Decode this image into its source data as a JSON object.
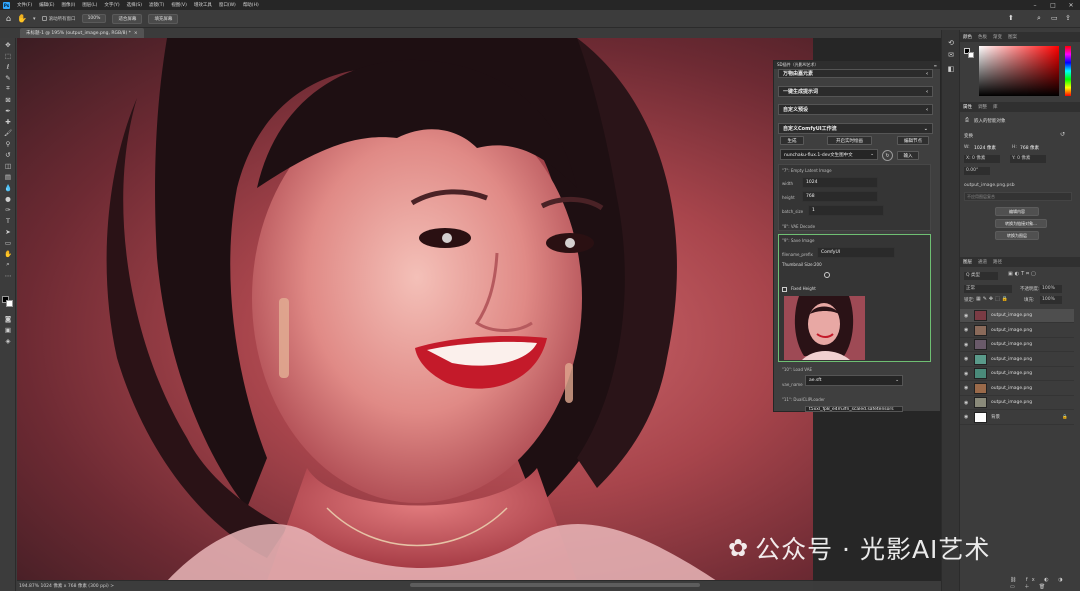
{
  "app": {
    "menus": [
      "文件(F)",
      "编辑(E)",
      "图像(I)",
      "图层(L)",
      "文字(Y)",
      "选择(S)",
      "滤镜(T)",
      "视图(V)",
      "增效工具",
      "窗口(W)",
      "帮助(H)"
    ],
    "ps_logo": "Ps"
  },
  "options": {
    "scroll_all_windows": "滚动所有窗口",
    "zoom": "100%",
    "fit_screen": "适合屏幕",
    "fill_screen": "填充屏幕"
  },
  "document": {
    "tab_title": "未标题-1 @ 195% (output_image.png, RGB/8) *",
    "status": "194.87%   1024 像素 x 768 像素 (300 ppi)   >"
  },
  "comfy": {
    "panel_title": "SD插件（光影AI艺术）",
    "sections": {
      "quick": "万物由嘉元素",
      "prompt": "一键生成提示词",
      "preset": "自定义预设",
      "workflow": "自定义ComfyUI工作流"
    },
    "buttons": {
      "generate": "生成",
      "realtime": "开启实时绘画",
      "edit_node": "编辑节点",
      "import": "输入"
    },
    "workflow_select": "nunchaku-flux.1-dev文生图中文",
    "nodes": {
      "latent": "\"7\": Empty Latent Image",
      "width_label": "width",
      "width_value": "1024",
      "height_label": "height",
      "height_value": "768",
      "batch_label": "batch_size",
      "batch_value": "1",
      "vae_decode": "\"8\": VAE Decode",
      "save_image": "\"9\": Save Image",
      "filename_label": "filename_prefix",
      "filename_value": "ComfyUI",
      "thumb_size": "Thumbnail Size:200",
      "fixed_height": "Fixed Height",
      "load_vae": "\"10\": Load VAE",
      "vae_label": "vae_name",
      "vae_value": "ae.sft",
      "dual_clip": "\"11\": DualCLIPLoader",
      "clip_value": "t5xxl_fp8_e4m3fn_scaled.safetensors"
    }
  },
  "right": {
    "color_tabs": [
      "颜色",
      "色板",
      "渐变",
      "图案"
    ],
    "props_tabs": [
      "属性",
      "调整",
      "库"
    ],
    "smart_object": "嵌入的智能对象",
    "transform_label": "变换",
    "w_label": "W:",
    "w_value": "1024 像素",
    "h_label": "H:",
    "h_value": "768 像素",
    "x_label": "X:",
    "x_value": "0 像素",
    "y_label": "Y:",
    "y_value": "0 像素",
    "angle": "0.00°",
    "file_name": "output_image.png.psb",
    "layer_comp": "不应用图层复合",
    "edit_contents": "编辑内容",
    "convert_layers": "转换为链接对象...",
    "convert_layer": "转换为图层",
    "layers_tabs": [
      "图层",
      "通道",
      "路径"
    ],
    "kind": "Q 类型",
    "blend": "正常",
    "opacity_label": "不透明度:",
    "opacity": "100%",
    "lock_label": "锁定:",
    "fill_label": "填充:",
    "fill": "100%",
    "layers": [
      {
        "name": "output_image.png",
        "selected": true,
        "tint": "#7a3b44"
      },
      {
        "name": "output_image.png",
        "selected": false,
        "tint": "#8a6a5a"
      },
      {
        "name": "output_image.png",
        "selected": false,
        "tint": "#6a5a6a"
      },
      {
        "name": "output_image.png",
        "selected": false,
        "tint": "#5a9a8a"
      },
      {
        "name": "output_image.png",
        "selected": false,
        "tint": "#4a8a7a"
      },
      {
        "name": "output_image.png",
        "selected": false,
        "tint": "#9a6a4a"
      },
      {
        "name": "output_image.png",
        "selected": false,
        "tint": "#8a8a7a"
      },
      {
        "name": "背景",
        "selected": false,
        "tint": "#ffffff"
      }
    ]
  },
  "watermark": "公众号 · 光影AI艺术"
}
